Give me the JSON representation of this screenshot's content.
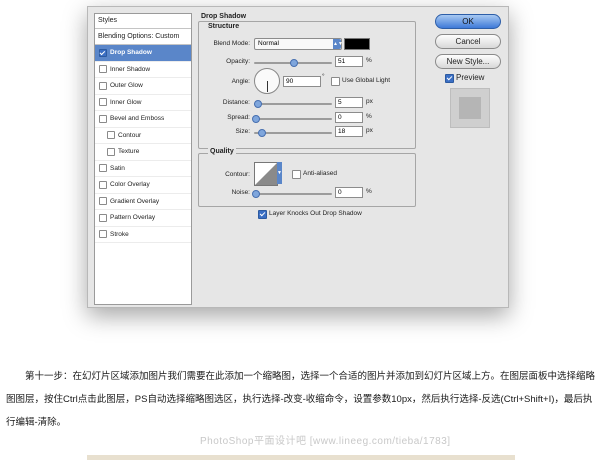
{
  "styles_panel": {
    "header": "Styles",
    "blending": "Blending Options: Custom",
    "items": [
      {
        "label": "Drop Shadow",
        "checked": true,
        "active": true,
        "sub": false
      },
      {
        "label": "Inner Shadow",
        "checked": false,
        "active": false,
        "sub": false
      },
      {
        "label": "Outer Glow",
        "checked": false,
        "active": false,
        "sub": false
      },
      {
        "label": "Inner Glow",
        "checked": false,
        "active": false,
        "sub": false
      },
      {
        "label": "Bevel and Emboss",
        "checked": false,
        "active": false,
        "sub": false
      },
      {
        "label": "Contour",
        "checked": false,
        "active": false,
        "sub": true
      },
      {
        "label": "Texture",
        "checked": false,
        "active": false,
        "sub": true
      },
      {
        "label": "Satin",
        "checked": false,
        "active": false,
        "sub": false
      },
      {
        "label": "Color Overlay",
        "checked": false,
        "active": false,
        "sub": false
      },
      {
        "label": "Gradient Overlay",
        "checked": false,
        "active": false,
        "sub": false
      },
      {
        "label": "Pattern Overlay",
        "checked": false,
        "active": false,
        "sub": false
      },
      {
        "label": "Stroke",
        "checked": false,
        "active": false,
        "sub": false
      }
    ]
  },
  "drop_shadow": {
    "title": "Drop Shadow",
    "structure_title": "Structure",
    "blend_mode_label": "Blend Mode:",
    "blend_mode_value": "Normal",
    "shadow_color": "#000000",
    "opacity_label": "Opacity:",
    "opacity_value": "51",
    "opacity_unit": "%",
    "opacity_fraction": 0.51,
    "angle_label": "Angle:",
    "angle_value": "90",
    "angle_unit": "°",
    "use_global_light_label": "Use Global Light",
    "use_global_light": false,
    "distance_label": "Distance:",
    "distance_value": "5",
    "distance_unit": "px",
    "spread_label": "Spread:",
    "spread_value": "0",
    "spread_unit": "%",
    "size_label": "Size:",
    "size_value": "18",
    "size_unit": "px",
    "quality_title": "Quality",
    "contour_label": "Contour:",
    "anti_aliased_label": "Anti-aliased",
    "noise_label": "Noise:",
    "noise_value": "0",
    "noise_unit": "%",
    "knocks_out_label": "Layer Knocks Out Drop Shadow",
    "knocks_out": true
  },
  "buttons": {
    "ok": "OK",
    "cancel": "Cancel",
    "new_style": "New Style...",
    "preview_label": "Preview",
    "preview_checked": true
  },
  "article": {
    "paragraph": "第十一步：在幻灯片区域添加图片我们需要在此添加一个缩略图，选择一个合适的图片并添加到幻灯片区域上方。在图层面板中选择缩略图图层，按住Ctrl点击此图层，PS自动选择缩略图选区，执行选择-改变-收缩命令，设置参数10px，然后执行选择-反选(Ctrl+Shift+I)，最后执行编辑-清除。",
    "watermark": "PhotoShop平面设计吧 [www.lineeg.com/tieba/1783]"
  }
}
